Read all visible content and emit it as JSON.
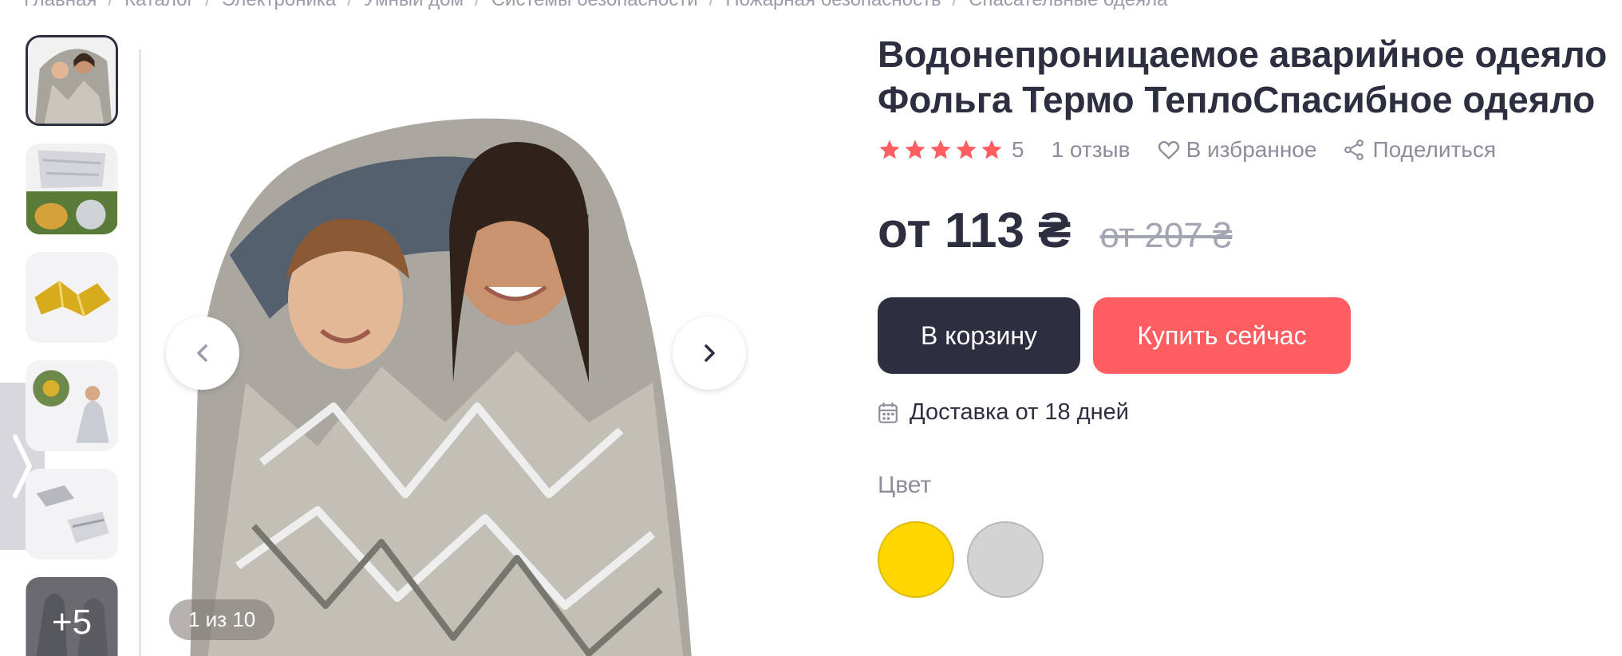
{
  "breadcrumb": [
    "Главная",
    "Каталог",
    "Электроника",
    "Умный дом",
    "Системы безопасности",
    "Пожарная безопасность",
    "Спасательные одеяла"
  ],
  "breadcrumb_separator": "/",
  "gallery": {
    "thumbnails": [
      {
        "icon": "thumbnail-children-foil-blanket"
      },
      {
        "icon": "thumbnail-silver-blanket-usage"
      },
      {
        "icon": "thumbnail-gold-blanket"
      },
      {
        "icon": "thumbnail-blanket-use-scenes"
      },
      {
        "icon": "thumbnail-folded-blankets"
      },
      {
        "icon": "thumbnail-more-images",
        "overlay": "+5"
      }
    ],
    "counter": "1 из 10",
    "main_image_icon": "children-wrapped-in-foil-blanket"
  },
  "product": {
    "title_line1": "Водонепроницаемое аварийное одеяло",
    "title_line2": "Фольга Термо ТеплоСпасибное одеяло",
    "rating": "5",
    "stars_filled": 5,
    "star_color": "#fe5e62",
    "reviews": "1 отзыв",
    "favorite": "В избранное",
    "share": "Поделиться",
    "price": "от 113 ₴",
    "old_price": "от 207 ₴",
    "cart_button": "В корзину",
    "buy_button": "Купить сейчас",
    "delivery": "Доставка от 18 дней",
    "color_label": "Цвет",
    "colors": [
      "#ffd700",
      "#d3d3d3"
    ]
  },
  "colors": {
    "primary_dark": "#2d2f41",
    "accent": "#fe5e62"
  }
}
